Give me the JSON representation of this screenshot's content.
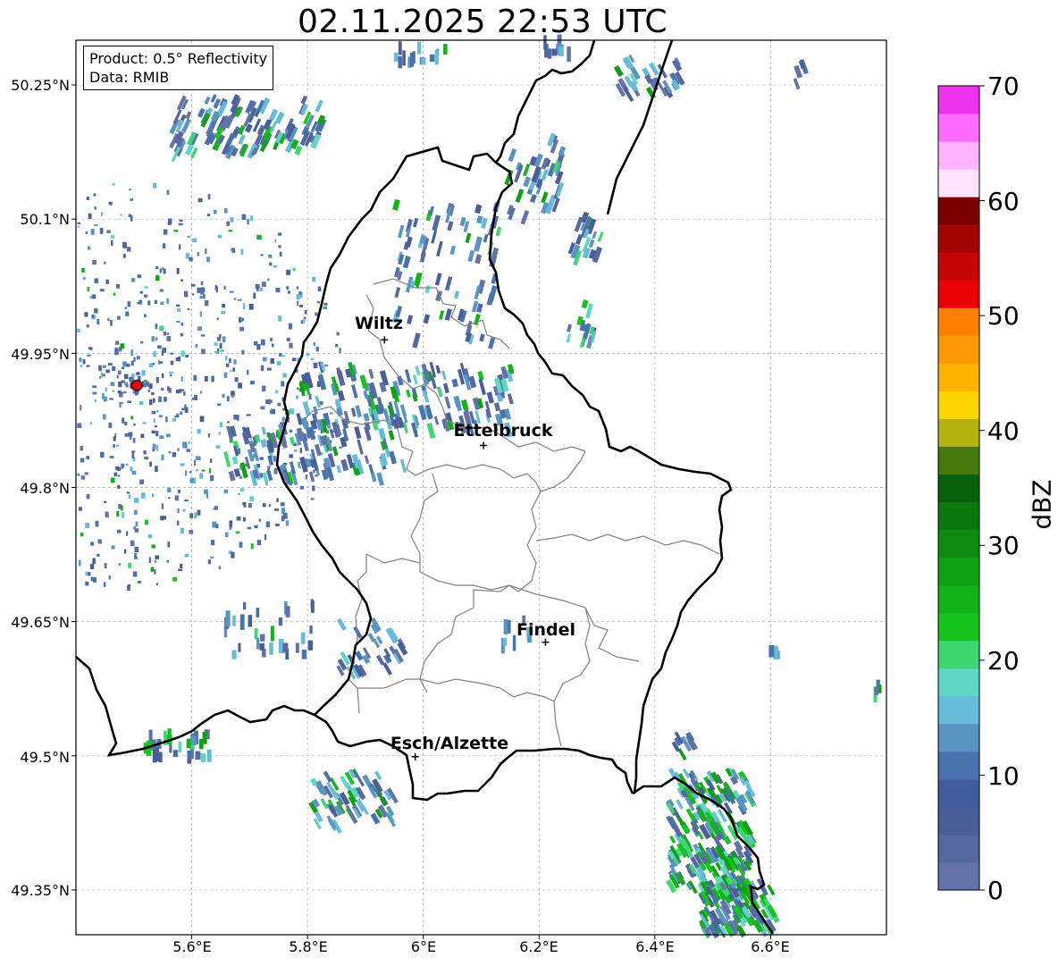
{
  "title": "02.11.2025 22:53 UTC",
  "info": {
    "product": "Product: 0.5° Reflectivity",
    "source": "Data: RMIB"
  },
  "lat_labels": [
    "50.25°N",
    "50.1°N",
    "49.95°N",
    "49.8°N",
    "49.65°N",
    "49.5°N",
    "49.35°N"
  ],
  "lon_labels": [
    "5.6°E",
    "5.8°E",
    "6°E",
    "6.2°E",
    "6.4°E",
    "6.6°E"
  ],
  "cities": [
    {
      "name": "Wiltz",
      "lat": 49.965,
      "lon": 5.933
    },
    {
      "name": "Ettelbruck",
      "lat": 49.847,
      "lon": 6.104
    },
    {
      "name": "Findel",
      "lat": 49.627,
      "lon": 6.211
    },
    {
      "name": "Esch/Alzette",
      "lat": 49.499,
      "lon": 5.986
    }
  ],
  "radar_site": {
    "lat": 49.914,
    "lon": 5.505
  },
  "colorbar": {
    "label": "dBZ",
    "ticks": [
      "0",
      "10",
      "20",
      "30",
      "40",
      "50",
      "60",
      "70"
    ],
    "colors": [
      "#6373a8",
      "#55689f",
      "#4a5f98",
      "#415d9e",
      "#4a72ac",
      "#5a95c2",
      "#66bcd8",
      "#5dd6c4",
      "#3dd670",
      "#15c41d",
      "#12b218",
      "#10a014",
      "#0e8c11",
      "#0b780e",
      "#085f0c",
      "#467a0f",
      "#b2b30d",
      "#ffd400",
      "#ffb301",
      "#fe9903",
      "#fe8002",
      "#e80206",
      "#c50606",
      "#a30504",
      "#7b0000",
      "#ffe2ff",
      "#ffb4ff",
      "#ff6bff",
      "#ee33ee"
    ]
  },
  "map_extent": {
    "lon_min": 5.4,
    "lon_max": 6.8,
    "lat_min": 49.3,
    "lat_max": 50.3
  },
  "colors": {
    "border": "#000000",
    "canton": "#808080",
    "grid": "#b0b0b0",
    "radar_marker": "#e00000"
  }
}
